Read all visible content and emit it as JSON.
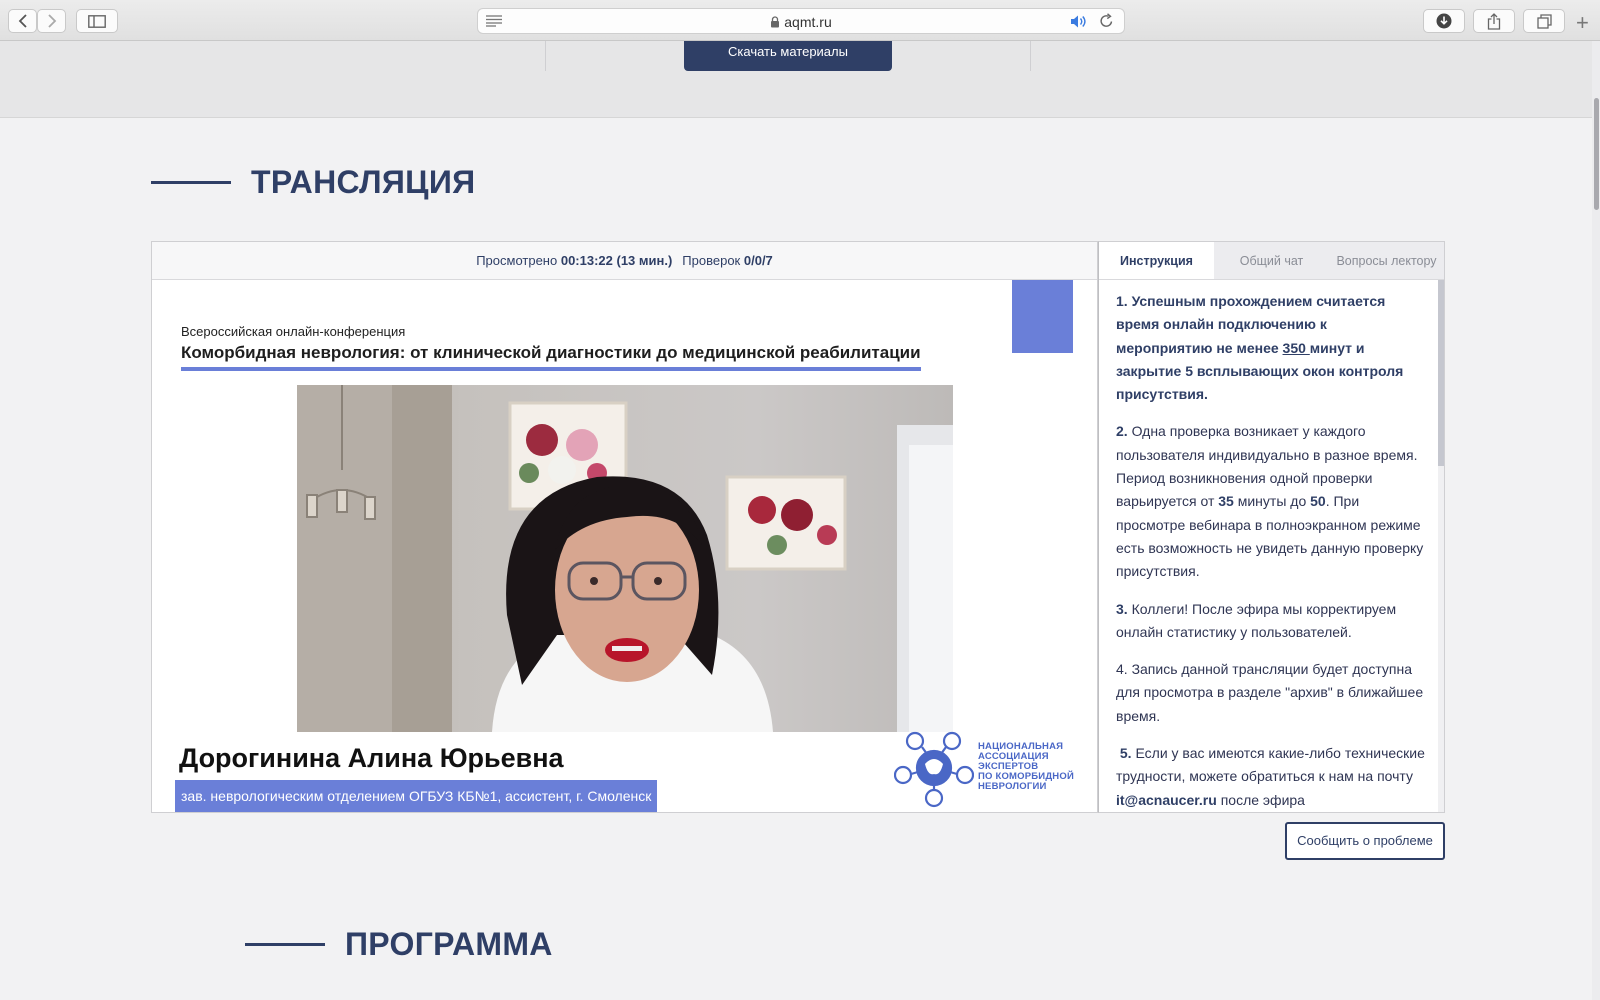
{
  "browser": {
    "url": "aqmt.ru",
    "add_tab": "+"
  },
  "top": {
    "download_label": "Скачать материалы"
  },
  "sections": {
    "broadcast_title": "ТРАНСЛЯЦИЯ",
    "program_title": "ПРОГРАММА"
  },
  "player": {
    "watched_label": "Просмотрено",
    "watched_value": "00:13:22 (13 мин.)",
    "checks_label": "Проверок",
    "checks_value": "0/0/7"
  },
  "slide": {
    "conference_type": "Всероссийская онлайн-конференция",
    "conference_title": "Коморбидная неврология: от клинической диагностики до медицинской реабилитации",
    "speaker_name": "Дорогинина Алина Юрьевна",
    "speaker_role": "зав. неврологическим отделением ОГБУЗ КБ№1, ассистент, г. Смоленск",
    "logo_line1": "НАЦИОНАЛЬНАЯ",
    "logo_line2": "АССОЦИАЦИЯ",
    "logo_line3": "ЭКСПЕРТОВ",
    "logo_line4": "ПО КОМОРБИДНОЙ",
    "logo_line5": "НЕВРОЛОГИИ"
  },
  "side": {
    "tabs": [
      {
        "label": "Инструкция",
        "active": true
      },
      {
        "label": "Общий чат",
        "active": false
      },
      {
        "label": "Вопросы лектору",
        "active": false
      }
    ],
    "p1_a": "1. Успешным прохождением считается время онлайн подключению к мероприятию не менее ",
    "p1_num": "350 ",
    "p1_b": "минут и закрытие 5 всплывающих окон контроля присутствия.",
    "p2_num": "2.",
    "p2_a": " Одна проверка возникает у каждого пользователя индивидуально в разное время. Период возникновения одной проверки варьируется от ",
    "p2_n1": "35",
    "p2_b": " минуты до ",
    "p2_n2": "50",
    "p2_c": ". При просмотре вебинара в полноэкранном режиме есть возможность не увидеть данную проверку присутствия.",
    "p3_num": "3.",
    "p3_text": " Коллеги! После эфира мы корректируем онлайн статистику у пользователей.",
    "p4_text": "4. Запись данной трансляции будет доступна для просмотра в разделе \"архив\" в ближайшее время.",
    "p5_num": "5.",
    "p5_a": " Если у вас имеются какие-либо технические трудности, можете обратиться к нам на почту ",
    "p5_email": "it@acnaucer.ru",
    "p5_b": " после эфира"
  },
  "report_label": "Сообщить о проблеме",
  "colors": {
    "navy": "#2f3f66",
    "accent_blue": "#6a7fd8",
    "logo_blue": "#4a67c6"
  }
}
